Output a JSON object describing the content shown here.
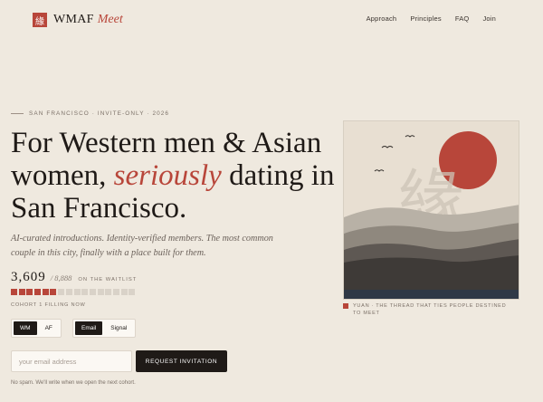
{
  "brand": {
    "mark_glyph": "緣",
    "name": "WMAF",
    "sub": "Meet",
    "accent_color": "#b8463a"
  },
  "nav": {
    "items": [
      {
        "label": "Approach"
      },
      {
        "label": "Principles"
      },
      {
        "label": "FAQ"
      },
      {
        "label": "Join"
      }
    ]
  },
  "hero": {
    "eyebrow": "SAN FRANCISCO · INVITE-ONLY · 2026",
    "headline_part1": "For Western men & Asian women, ",
    "headline_accent": "seriously",
    "headline_part2": " dating in San Francisco.",
    "subcopy": "AI-curated introductions. Identity-verified members. The most common couple in this city, finally with a place built for them."
  },
  "waitlist": {
    "count": "3,609",
    "cap": "/ 8,888",
    "label": "ON THE WAITLIST",
    "slots_total": 16,
    "slots_filled": 6,
    "cohort_status": "COHORT 1 FILLING NOW"
  },
  "toggles": {
    "identity": {
      "options": [
        "WM",
        "AF"
      ],
      "selected": "WM"
    },
    "contact": {
      "options": [
        "Email",
        "Signal"
      ],
      "selected": "Email"
    }
  },
  "form": {
    "email_placeholder": "your email address",
    "email_value": "",
    "submit_label": "REQUEST INVITATION",
    "fineprint": "No spam. We'll write when we open the next cohort."
  },
  "artwork": {
    "glyph": "緣",
    "caption": "YUAN · THE THREAD THAT TIES PEOPLE DESTINED TO MEET",
    "colors": {
      "sky": "#e8dfd2",
      "sun": "#b8463a",
      "hill1": "#b8b1a6",
      "hill2": "#8f887e",
      "hill3": "#5e5853",
      "hill4": "#3e3a37",
      "water": "#2f3846"
    }
  }
}
